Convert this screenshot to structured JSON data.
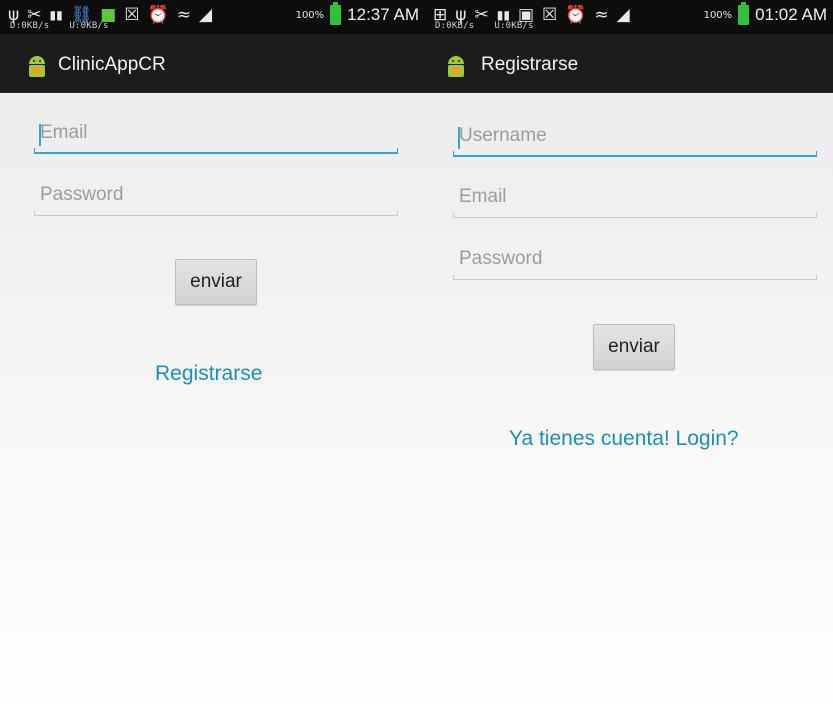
{
  "colors": {
    "statusbar": "#0d0d0d",
    "actionbar": "#1c1c1c",
    "accent_focus": "#33a4d6",
    "link": "#1a8fb8",
    "hint_text": "#9c9c9c",
    "battery": "#2fc13a"
  },
  "left_screen": {
    "status_bar": {
      "download_speed": "D:0KB/s",
      "upload_speed": "U:0KB/s",
      "battery_percent": "100%",
      "clock": "12:37 AM",
      "icons": [
        "usb-icon",
        "broom-icon",
        "signal-icon",
        "shield-icon",
        "android-icon",
        "mute-icon",
        "alarm-icon",
        "wifi-icon",
        "cell-signal-icon",
        "battery-icon"
      ]
    },
    "action_bar": {
      "title": "ClinicAppCR",
      "icon": "android-app-icon"
    },
    "form": {
      "email_placeholder": "Email",
      "password_placeholder": "Password",
      "submit_label": "enviar",
      "link_label": "Registrarse"
    }
  },
  "right_screen": {
    "status_bar": {
      "download_speed": "D:0KB/s",
      "upload_speed": "U:0KB/s",
      "battery_percent": "100%",
      "clock": "01:02 AM",
      "icons": [
        "plus-icon",
        "usb-icon",
        "broom-icon",
        "signal-icon",
        "image-icon",
        "mute-icon",
        "alarm-icon",
        "wifi-icon",
        "cell-signal-icon",
        "battery-icon"
      ]
    },
    "action_bar": {
      "title": "Registrarse",
      "icon": "android-app-icon"
    },
    "form": {
      "username_placeholder": "Username",
      "email_placeholder": "Email",
      "password_placeholder": "Password",
      "submit_label": "enviar",
      "link_label": "Ya tienes cuenta! Login?"
    }
  }
}
